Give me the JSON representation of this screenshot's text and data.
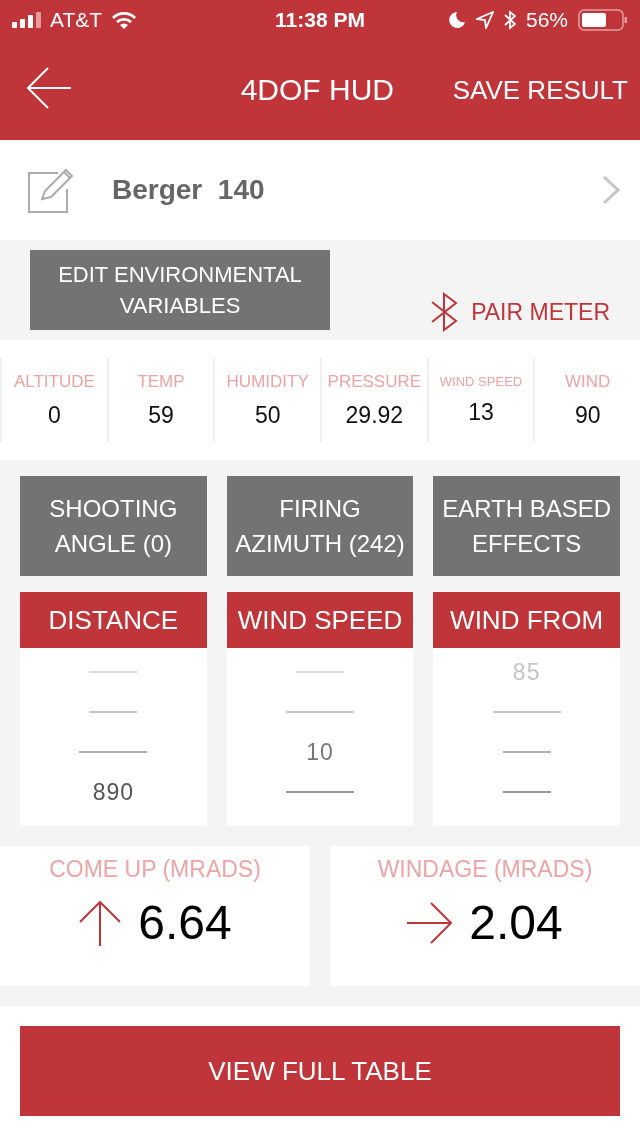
{
  "status_bar": {
    "carrier": "AT&T",
    "time": "11:38 PM",
    "battery": "56%"
  },
  "header": {
    "title": "4DOF HUD",
    "action": "SAVE RESULT"
  },
  "bullet": {
    "name": "Berger",
    "weight": "140"
  },
  "environment_button": "EDIT ENVIRONMENTAL VARIABLES",
  "pair_meter": "PAIR METER",
  "environment": [
    {
      "label": "ALTITUDE",
      "value": "0",
      "small": false
    },
    {
      "label": "TEMP",
      "value": "59",
      "small": false
    },
    {
      "label": "HUMIDITY",
      "value": "50",
      "small": false
    },
    {
      "label": "PRESSURE",
      "value": "29.92",
      "small": false
    },
    {
      "label": "WIND SPEED",
      "value": "13",
      "small": true
    },
    {
      "label": "WIND",
      "value": "90",
      "small": false
    }
  ],
  "option_buttons": [
    "SHOOTING ANGLE (0)",
    "FIRING AZIMUTH (242)",
    "EARTH BASED EFFECTS"
  ],
  "pickers": [
    {
      "title": "DISTANCE",
      "rows": [
        {
          "kind": "dash",
          "wide": false
        },
        {
          "kind": "dash",
          "wide": false
        },
        {
          "kind": "dash",
          "wide": true
        },
        {
          "kind": "value",
          "text": "890"
        }
      ]
    },
    {
      "title": "WIND SPEED",
      "rows": [
        {
          "kind": "dash",
          "wide": false
        },
        {
          "kind": "dash",
          "wide": true
        },
        {
          "kind": "value",
          "text": "10"
        },
        {
          "kind": "dash",
          "wide": true
        }
      ]
    },
    {
      "title": "WIND FROM",
      "rows": [
        {
          "kind": "value",
          "text": "85"
        },
        {
          "kind": "dash",
          "wide": true
        },
        {
          "kind": "dash",
          "wide": false
        },
        {
          "kind": "dash",
          "wide": false
        }
      ]
    }
  ],
  "results": [
    {
      "label": "COME UP (MRADS)",
      "value": "6.64",
      "kind": "up"
    },
    {
      "label": "WINDAGE (MRADS)",
      "value": "2.04",
      "kind": "right"
    }
  ],
  "footer_button": "VIEW FULL TABLE"
}
